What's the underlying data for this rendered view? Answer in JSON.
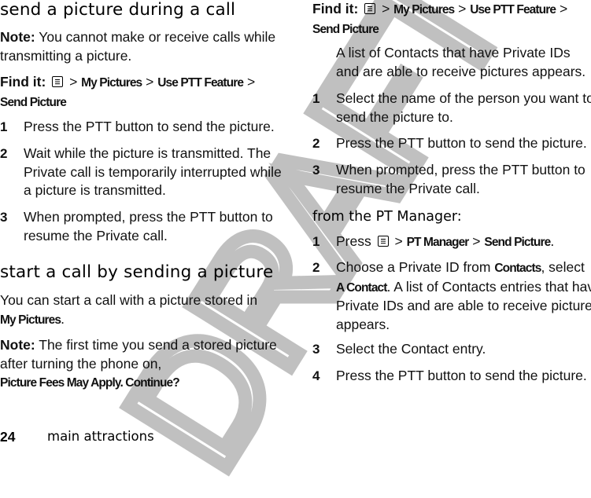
{
  "page": {
    "number": "24",
    "section_label": "main attractions",
    "watermark": "DRAFT"
  },
  "icons": {
    "menu_key": "menu-key-icon"
  },
  "left_column": {
    "section1": {
      "title": "send a picture during a call",
      "note_label": "Note:",
      "note_text": " You cannot make or receive calls while transmitting a picture.",
      "find_it_label": "Find it:",
      "path": [
        "My Pictures",
        "Use PTT Feature",
        "Send Picture"
      ],
      "separator": ">",
      "steps": [
        {
          "num": "1",
          "text": "Press the PTT button to send the picture."
        },
        {
          "num": "2",
          "text": "Wait while the picture is transmitted. The Private call is temporarily interrupted while a picture is transmitted."
        },
        {
          "num": "3",
          "text": "When prompted, press the PTT button to resume the Private call."
        }
      ]
    },
    "section2": {
      "title": "start a call by sending a picture",
      "intro_text": "You can start a call with a picture stored in ",
      "intro_bold": "My Pictures",
      "intro_end": ".",
      "note_label": "Note:",
      "note_text": " The first time you send a stored picture after turning the phone on, ",
      "note_bold": "Picture Fees May Apply. Continue?"
    }
  },
  "right_column": {
    "find_it_label": "Find it:",
    "path": [
      "My Pictures",
      "Use PTT Feature",
      "Send Picture"
    ],
    "separator": ">",
    "description": "A list of Contacts that have Private IDs and are able to receive pictures appears.",
    "steps": [
      {
        "num": "1",
        "text": "Select the name of the person you want to send the picture to."
      },
      {
        "num": "2",
        "text": "Press the PTT button to send the picture."
      },
      {
        "num": "3",
        "text": "When prompted, press the PTT button to resume the Private call."
      }
    ],
    "subsection": {
      "title": "from the PT Manager:",
      "step1": {
        "num": "1",
        "prefix": "Press ",
        "path": [
          "PT Manager",
          "Send Picture"
        ],
        "end": "."
      },
      "step2": {
        "num": "2",
        "t1": "Choose a Private ID from ",
        "b1": "Contacts",
        "t2": ", select ",
        "b2": "A Contact",
        "t3": ". A list of Contacts entries that have Private IDs and are able to receive pictures appears."
      },
      "step3": {
        "num": "3",
        "text": "Select the Contact entry."
      },
      "step4": {
        "num": "4",
        "text": "Press the PTT button to send the picture."
      }
    }
  }
}
